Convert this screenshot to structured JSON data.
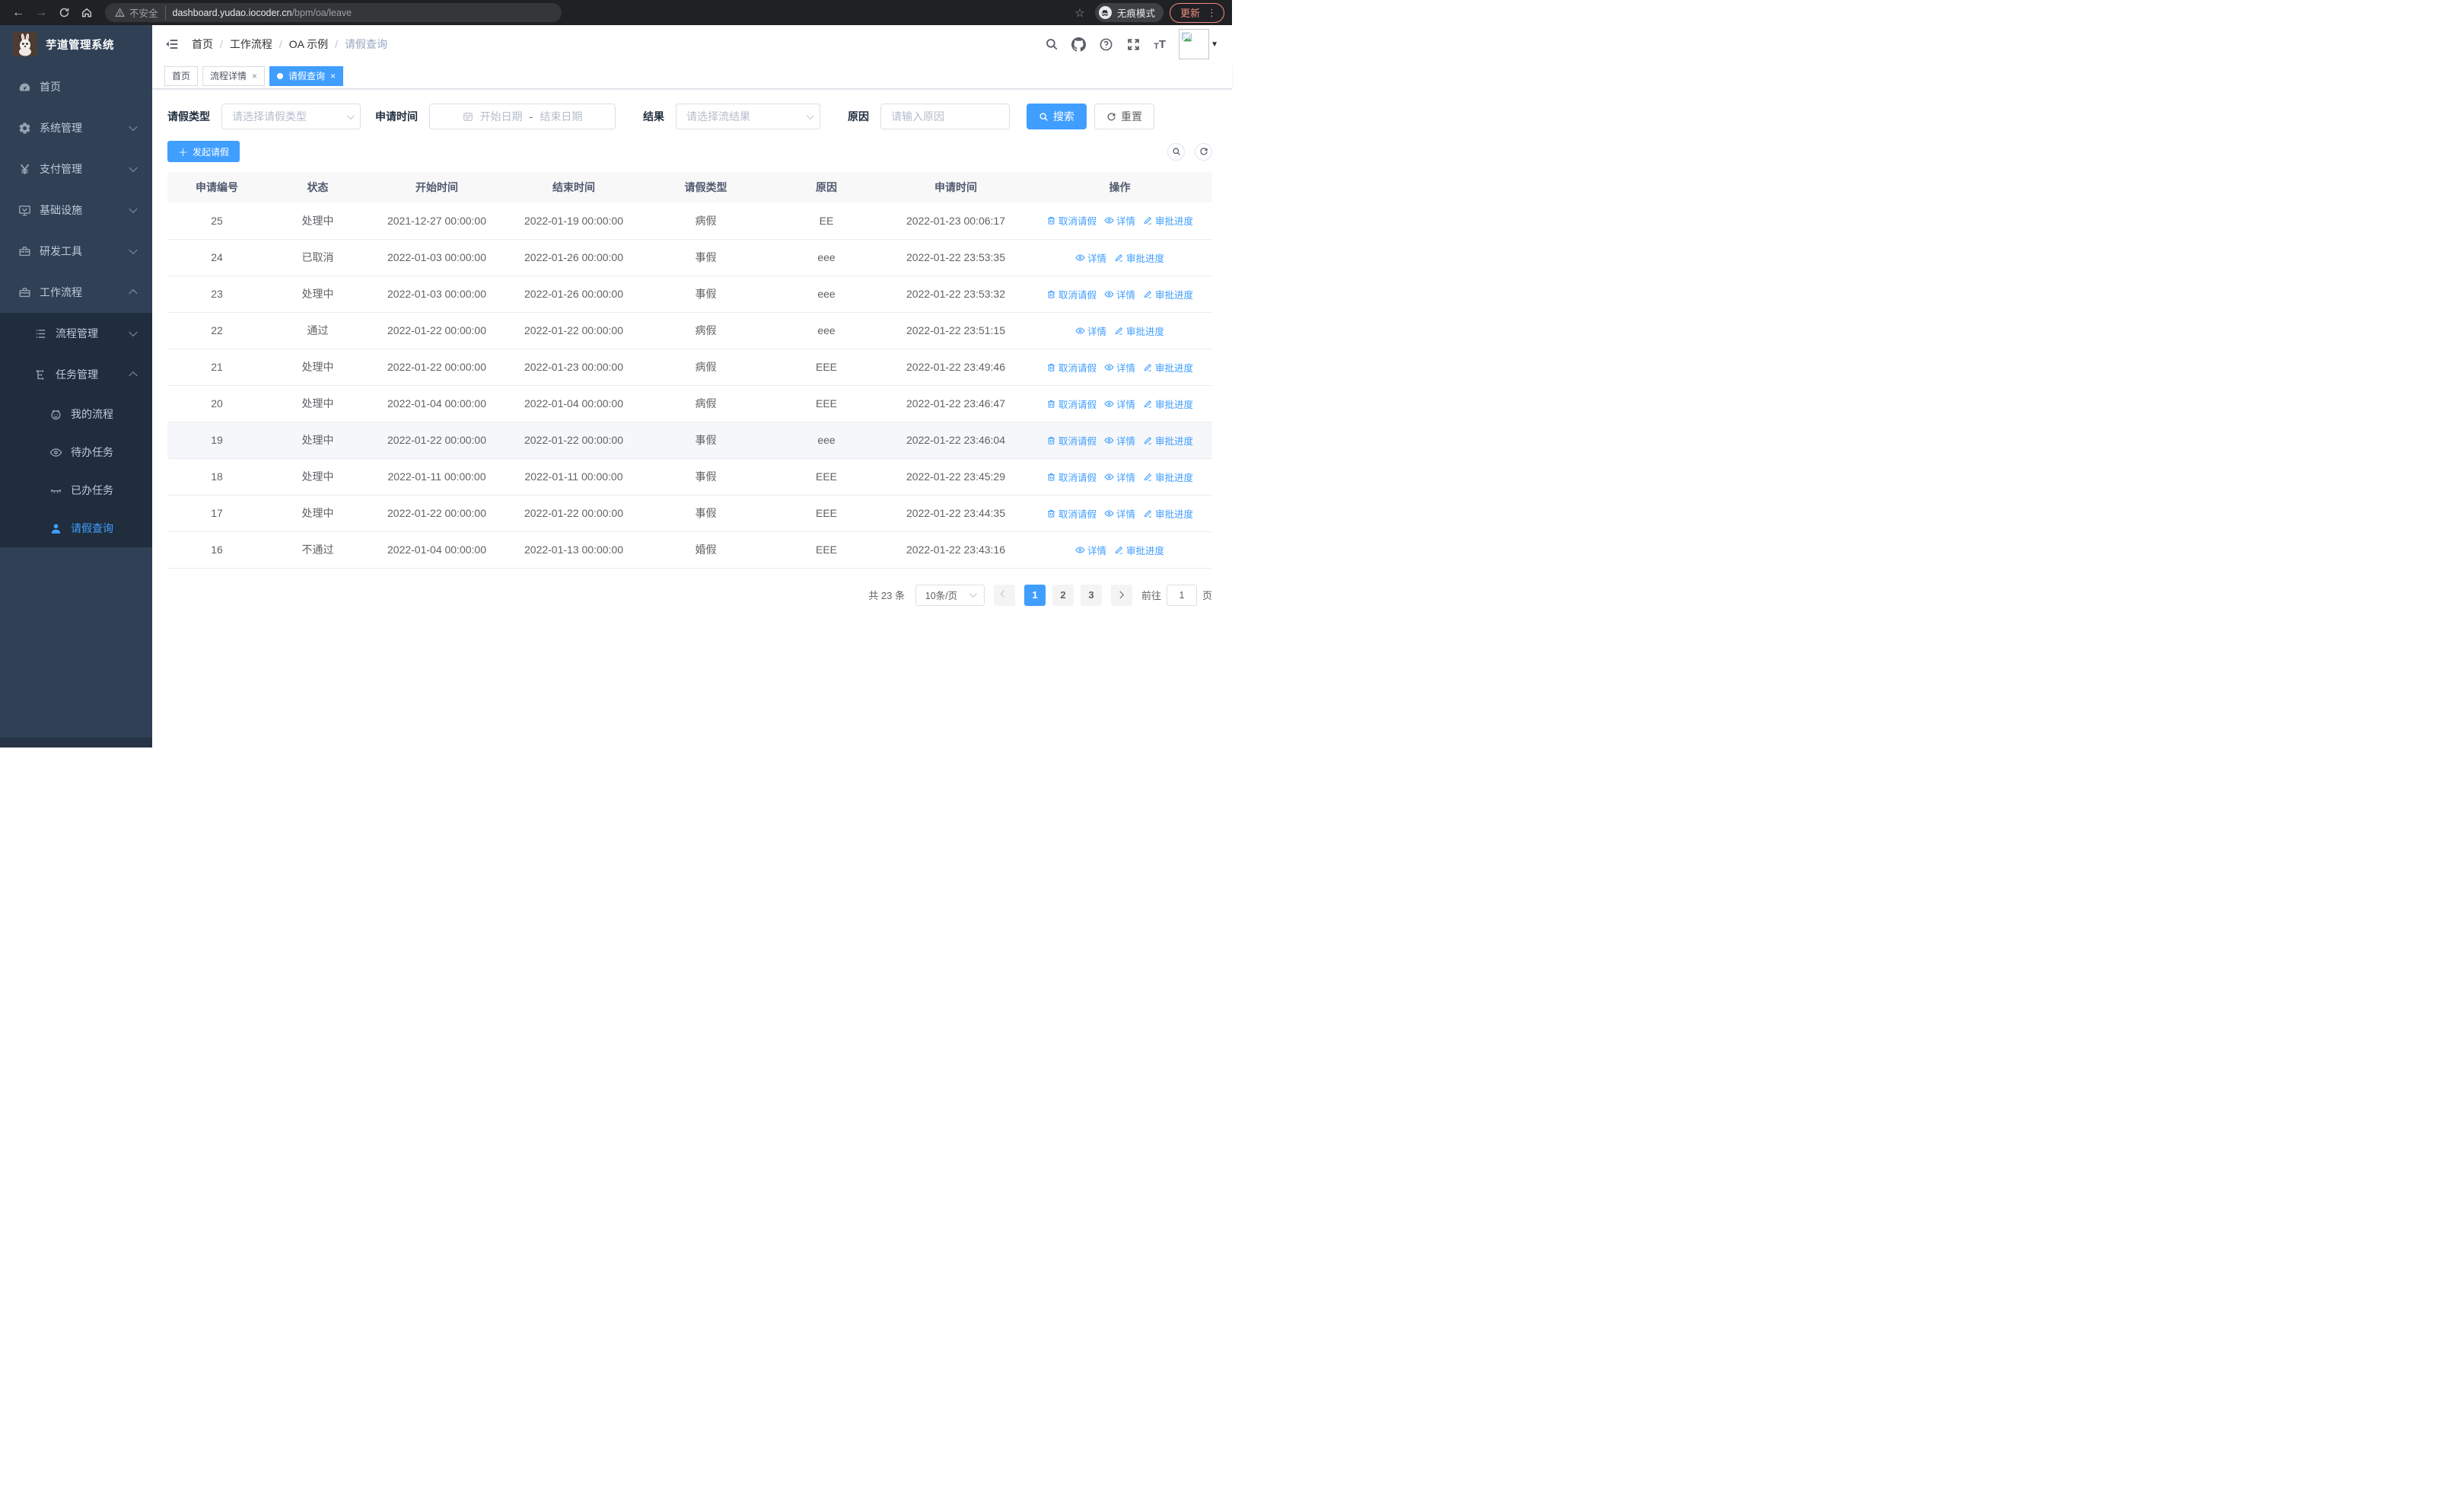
{
  "browser": {
    "security_label": "不安全",
    "url_host": "dashboard.yudao.iocoder.cn",
    "url_path": "/bpm/oa/leave",
    "incognito_label": "无痕模式",
    "update_label": "更新"
  },
  "sidebar": {
    "logo_title": "芋道管理系统",
    "items": [
      {
        "label": "首页",
        "icon": "dashboard-icon",
        "arrow": null,
        "level": 0,
        "submenu": false
      },
      {
        "label": "系统管理",
        "icon": "gear-icon",
        "arrow": "down",
        "level": 0,
        "submenu": false
      },
      {
        "label": "支付管理",
        "icon": "yen-icon",
        "arrow": "down",
        "level": 0,
        "submenu": false
      },
      {
        "label": "基础设施",
        "icon": "monitor-icon",
        "arrow": "down",
        "level": 0,
        "submenu": false
      },
      {
        "label": "研发工具",
        "icon": "toolbox-icon",
        "arrow": "down",
        "level": 0,
        "submenu": false
      },
      {
        "label": "工作流程",
        "icon": "briefcase-icon",
        "arrow": "up",
        "level": 0,
        "submenu": false
      },
      {
        "label": "流程管理",
        "icon": "list-icon",
        "arrow": "down",
        "level": 1,
        "submenu": true
      },
      {
        "label": "任务管理",
        "icon": "tree-icon",
        "arrow": "up",
        "level": 1,
        "submenu": true
      },
      {
        "label": "我的流程",
        "icon": "robot-icon",
        "arrow": null,
        "level": 2,
        "submenu": true
      },
      {
        "label": "待办任务",
        "icon": "eye-icon",
        "arrow": null,
        "level": 2,
        "submenu": true
      },
      {
        "label": "已办任务",
        "icon": "eye-closed-icon",
        "arrow": null,
        "level": 2,
        "submenu": true
      },
      {
        "label": "请假查询",
        "icon": "user-icon",
        "arrow": null,
        "level": 2,
        "submenu": true,
        "active": true
      }
    ]
  },
  "breadcrumb": [
    "首页",
    "工作流程",
    "OA 示例",
    "请假查询"
  ],
  "tabs": [
    {
      "label": "首页",
      "closable": false,
      "active": false
    },
    {
      "label": "流程详情",
      "closable": true,
      "active": false
    },
    {
      "label": "请假查询",
      "closable": true,
      "active": true
    }
  ],
  "filters": {
    "type_label": "请假类型",
    "type_placeholder": "请选择请假类型",
    "time_label": "申请时间",
    "date_start_placeholder": "开始日期",
    "date_separator": "-",
    "date_end_placeholder": "结束日期",
    "result_label": "结果",
    "result_placeholder": "请选择流结果",
    "reason_label": "原因",
    "reason_placeholder": "请输入原因",
    "search_label": "搜索",
    "reset_label": "重置"
  },
  "toolbar": {
    "create_label": "发起请假"
  },
  "table": {
    "headers": [
      "申请编号",
      "状态",
      "开始时间",
      "结束时间",
      "请假类型",
      "原因",
      "申请时间",
      "操作"
    ],
    "action_labels": {
      "cancel": "取消请假",
      "detail": "详情",
      "progress": "审批进度"
    },
    "rows": [
      {
        "id": "25",
        "status": "处理中",
        "start": "2021-12-27 00:00:00",
        "end": "2022-01-19 00:00:00",
        "type": "病假",
        "reason": "EE",
        "apply": "2022-01-23 00:06:17",
        "actions": [
          "cancel",
          "detail",
          "progress"
        ],
        "hover": false
      },
      {
        "id": "24",
        "status": "已取消",
        "start": "2022-01-03 00:00:00",
        "end": "2022-01-26 00:00:00",
        "type": "事假",
        "reason": "eee",
        "apply": "2022-01-22 23:53:35",
        "actions": [
          "detail",
          "progress"
        ],
        "hover": false
      },
      {
        "id": "23",
        "status": "处理中",
        "start": "2022-01-03 00:00:00",
        "end": "2022-01-26 00:00:00",
        "type": "事假",
        "reason": "eee",
        "apply": "2022-01-22 23:53:32",
        "actions": [
          "cancel",
          "detail",
          "progress"
        ],
        "hover": false
      },
      {
        "id": "22",
        "status": "通过",
        "start": "2022-01-22 00:00:00",
        "end": "2022-01-22 00:00:00",
        "type": "病假",
        "reason": "eee",
        "apply": "2022-01-22 23:51:15",
        "actions": [
          "detail",
          "progress"
        ],
        "hover": false
      },
      {
        "id": "21",
        "status": "处理中",
        "start": "2022-01-22 00:00:00",
        "end": "2022-01-23 00:00:00",
        "type": "病假",
        "reason": "EEE",
        "apply": "2022-01-22 23:49:46",
        "actions": [
          "cancel",
          "detail",
          "progress"
        ],
        "hover": false
      },
      {
        "id": "20",
        "status": "处理中",
        "start": "2022-01-04 00:00:00",
        "end": "2022-01-04 00:00:00",
        "type": "病假",
        "reason": "EEE",
        "apply": "2022-01-22 23:46:47",
        "actions": [
          "cancel",
          "detail",
          "progress"
        ],
        "hover": false
      },
      {
        "id": "19",
        "status": "处理中",
        "start": "2022-01-22 00:00:00",
        "end": "2022-01-22 00:00:00",
        "type": "事假",
        "reason": "eee",
        "apply": "2022-01-22 23:46:04",
        "actions": [
          "cancel",
          "detail",
          "progress"
        ],
        "hover": true
      },
      {
        "id": "18",
        "status": "处理中",
        "start": "2022-01-11 00:00:00",
        "end": "2022-01-11 00:00:00",
        "type": "事假",
        "reason": "EEE",
        "apply": "2022-01-22 23:45:29",
        "actions": [
          "cancel",
          "detail",
          "progress"
        ],
        "hover": false
      },
      {
        "id": "17",
        "status": "处理中",
        "start": "2022-01-22 00:00:00",
        "end": "2022-01-22 00:00:00",
        "type": "事假",
        "reason": "EEE",
        "apply": "2022-01-22 23:44:35",
        "actions": [
          "cancel",
          "detail",
          "progress"
        ],
        "hover": false
      },
      {
        "id": "16",
        "status": "不通过",
        "start": "2022-01-04 00:00:00",
        "end": "2022-01-13 00:00:00",
        "type": "婚假",
        "reason": "EEE",
        "apply": "2022-01-22 23:43:16",
        "actions": [
          "detail",
          "progress"
        ],
        "hover": false
      }
    ]
  },
  "pagination": {
    "total_label": "共 23 条",
    "page_size_label": "10条/页",
    "pages": [
      "1",
      "2",
      "3"
    ],
    "active_page": "1",
    "goto_label": "前往",
    "goto_value": "1",
    "goto_suffix": "页"
  },
  "colors": {
    "accent": "#409EFF",
    "sidebar": "#304156",
    "submenu": "#1f2d3d",
    "update_chip": "#f28b82"
  }
}
